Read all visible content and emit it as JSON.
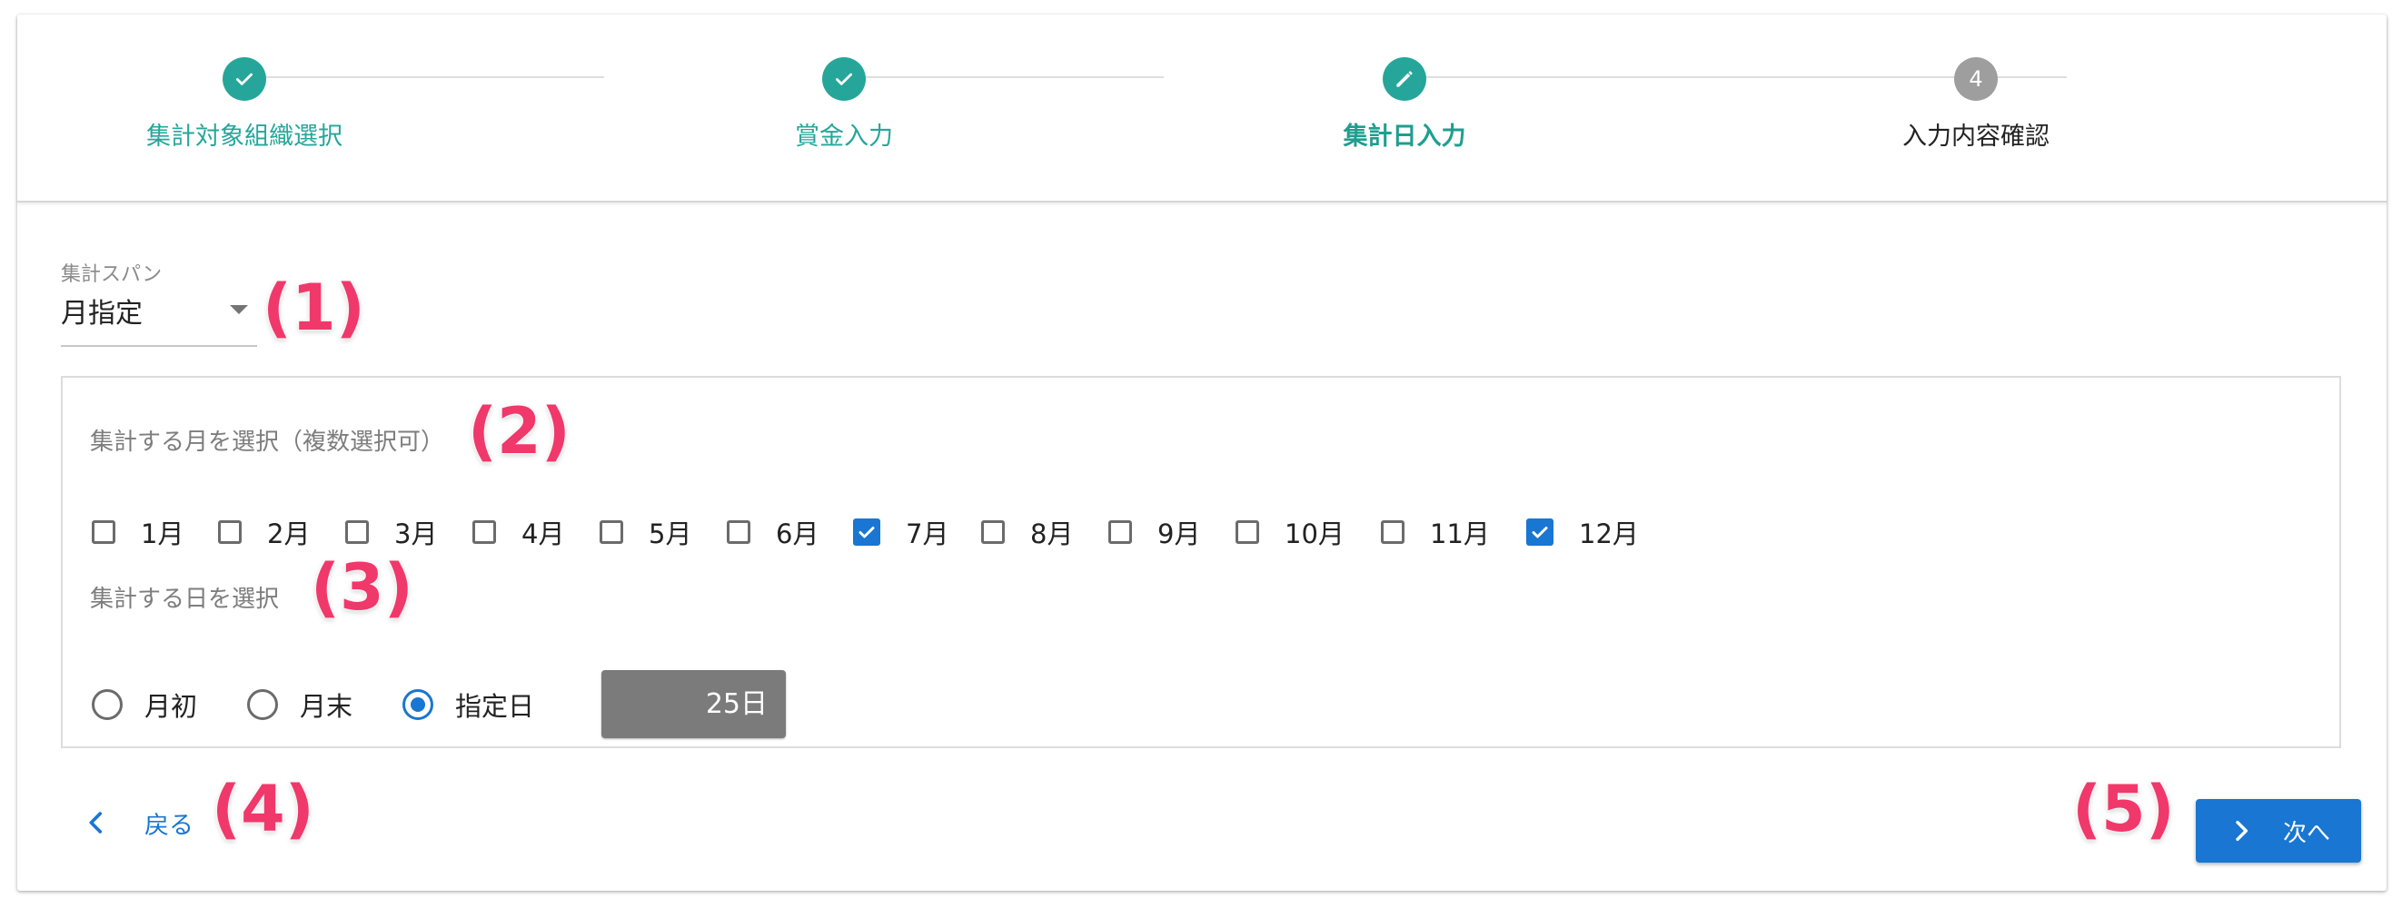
{
  "stepper": {
    "steps": [
      {
        "label": "集計対象組織選択",
        "state": "done",
        "icon": "check-icon"
      },
      {
        "label": "賞金入力",
        "state": "done",
        "icon": "check-icon"
      },
      {
        "label": "集計日入力",
        "state": "active",
        "icon": "pencil-icon"
      },
      {
        "label": "入力内容確認",
        "state": "todo",
        "number": "4"
      }
    ],
    "colors": {
      "done": "#26a69a",
      "todo": "#9e9e9e"
    }
  },
  "span_select": {
    "label": "集計スパン",
    "value": "月指定"
  },
  "months": {
    "label": "集計する月を選択（複数選択可）",
    "items": [
      {
        "label": "1月",
        "checked": false
      },
      {
        "label": "2月",
        "checked": false
      },
      {
        "label": "3月",
        "checked": false
      },
      {
        "label": "4月",
        "checked": false
      },
      {
        "label": "5月",
        "checked": false
      },
      {
        "label": "6月",
        "checked": false
      },
      {
        "label": "7月",
        "checked": true
      },
      {
        "label": "8月",
        "checked": false
      },
      {
        "label": "9月",
        "checked": false
      },
      {
        "label": "10月",
        "checked": false
      },
      {
        "label": "11月",
        "checked": false
      },
      {
        "label": "12月",
        "checked": true
      }
    ]
  },
  "days": {
    "label": "集計する日を選択",
    "options": [
      {
        "label": "月初",
        "selected": false
      },
      {
        "label": "月末",
        "selected": false
      },
      {
        "label": "指定日",
        "selected": true
      }
    ],
    "day_value": "25日"
  },
  "footer": {
    "back_label": "戻る",
    "next_label": "次へ"
  },
  "annotations": [
    "(1)",
    "(2)",
    "(3)",
    "(4)",
    "(5)"
  ],
  "accent_color": "#1976d2",
  "annotation_color": "#f0386b"
}
